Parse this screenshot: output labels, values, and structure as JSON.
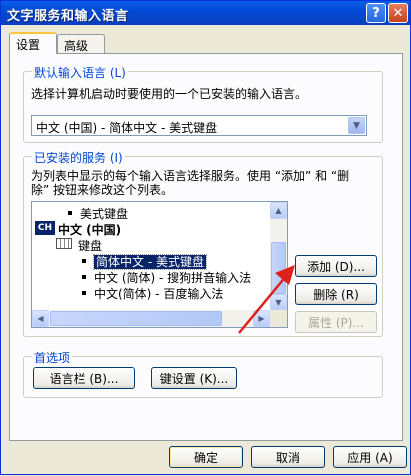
{
  "window": {
    "title": "文字服务和输入语言",
    "help_glyph": "?",
    "close_glyph": "✕"
  },
  "tabs": [
    {
      "label": "设置"
    },
    {
      "label": "高级"
    }
  ],
  "default_language": {
    "group_title": "默认输入语言 (L)",
    "description": "选择计算机启动时要使用的一个已安装的输入语言。",
    "selected": "中文 (中国) - 简体中文 - 美式键盘"
  },
  "installed_services": {
    "group_title": "已安装的服务 (I)",
    "description_line1": "为列表中显示的每个输入语言选择服务。使用 “添加” 和 “删",
    "description_line2": "除” 按钮来修改这个列表。",
    "tree": {
      "item_top": "美式键盘",
      "language_badge": "CH",
      "language": "中文 (中国)",
      "category": "键盘",
      "items": [
        "简体中文 - 美式键盘",
        "中文 (简体) - 搜狗拼音输入法",
        "中文(简体) - 百度输入法"
      ]
    },
    "buttons": {
      "add": "添加 (D)...",
      "remove": "删除 (R)",
      "properties": "属性 (P)..."
    }
  },
  "preferences": {
    "group_title": "首选项",
    "language_bar": "语言栏 (B)...",
    "key_settings": "键设置 (K)..."
  },
  "footer": {
    "ok": "确定",
    "cancel": "取消",
    "apply": "应用 (A)"
  },
  "colors": {
    "titlebar": "#0149d6",
    "group_title": "#0046d5",
    "annotation_arrow": "#e0201b"
  }
}
